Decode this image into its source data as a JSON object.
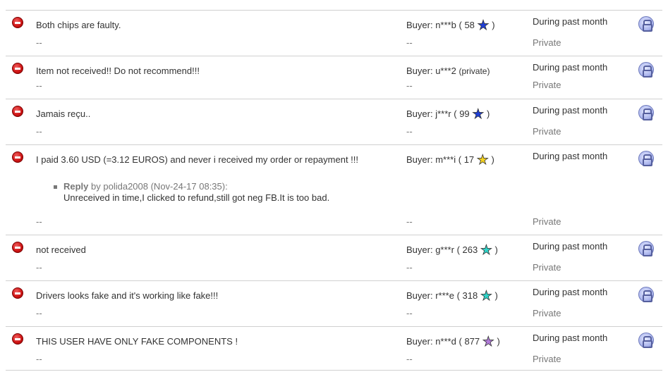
{
  "feedback": [
    {
      "comment": "Both chips are faulty.",
      "dash_left": "--",
      "buyer_label": "Buyer:",
      "buyer_name": "n***b",
      "buyer_open": "(",
      "buyer_score": "58",
      "buyer_close": ")",
      "star": "★",
      "star_color": "#1f3fd6",
      "dash_mid": "--",
      "time": "During past month",
      "privacy": "Private"
    },
    {
      "comment": "Item not received!! Do not recommend!!!",
      "dash_left": "--",
      "buyer_label": "Buyer:",
      "buyer_name": "u***2",
      "buyer_private": "(private)",
      "dash_mid": "--",
      "time": "During past month",
      "privacy": "Private"
    },
    {
      "comment": "Jamais reçu..",
      "dash_left": "--",
      "buyer_label": "Buyer:",
      "buyer_name": "j***r",
      "buyer_open": "(",
      "buyer_score": "99",
      "buyer_close": ")",
      "star": "★",
      "star_color": "#1f3fd6",
      "dash_mid": "--",
      "time": "During past month",
      "privacy": "Private"
    },
    {
      "comment": "I paid 3.60 USD (=3.12 EUROS) and never i received my order or repayment !!!",
      "dash_left": "--",
      "buyer_label": "Buyer:",
      "buyer_name": "m***i",
      "buyer_open": "(",
      "buyer_score": "17",
      "buyer_close": ")",
      "star": "★",
      "star_color": "#f4d21f",
      "dash_mid": "--",
      "time": "During past month",
      "privacy": "Private",
      "reply": {
        "label": "Reply",
        "by": "by polida2008 (Nov-24-17 08:35):",
        "text": "Unreceived in time,I clicked to refund,still got neg FB.It is too bad."
      }
    },
    {
      "comment": "not received",
      "dash_left": "--",
      "buyer_label": "Buyer:",
      "buyer_name": "g***r",
      "buyer_open": "(",
      "buyer_score": "263",
      "buyer_close": ")",
      "star": "★",
      "star_color": "#2ed3c8",
      "dash_mid": "--",
      "time": "During past month",
      "privacy": "Private"
    },
    {
      "comment": "Drivers looks fake and it's working like fake!!!",
      "dash_left": "--",
      "buyer_label": "Buyer:",
      "buyer_name": "r***e",
      "buyer_open": "(",
      "buyer_score": "318",
      "buyer_close": ")",
      "star": "★",
      "star_color": "#2ed3c8",
      "dash_mid": "--",
      "time": "During past month",
      "privacy": "Private"
    },
    {
      "comment": "THIS USER HAVE ONLY FAKE COMPONENTS !",
      "dash_left": "--",
      "buyer_label": "Buyer:",
      "buyer_name": "n***d",
      "buyer_open": "(",
      "buyer_score": "877",
      "buyer_close": ")",
      "star": "★",
      "star_color": "#b07ad8",
      "dash_mid": "--",
      "time": "During past month",
      "privacy": "Private"
    }
  ]
}
